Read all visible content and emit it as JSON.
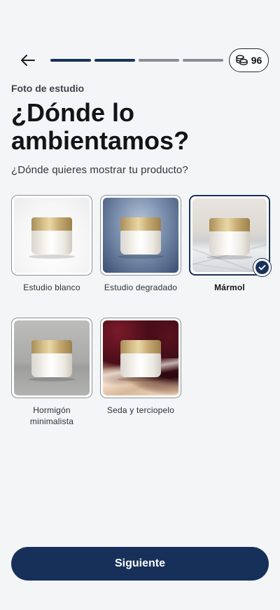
{
  "header": {
    "back_icon": "arrow-left-icon",
    "progress": {
      "total_steps": 4,
      "completed_steps": 2
    },
    "credits": {
      "icon": "coins-icon",
      "value": "96"
    }
  },
  "eyebrow": "Foto de estudio",
  "title": "¿Dónde lo ambientamos?",
  "subtitle": "¿Dónde quieres mostrar tu producto?",
  "options": [
    {
      "label": "Estudio blanco",
      "selected": false
    },
    {
      "label": "Estudio degradado",
      "selected": false
    },
    {
      "label": "Mármol",
      "selected": true
    },
    {
      "label": "Hormigón minimalista",
      "selected": false
    },
    {
      "label": "Seda y terciopelo",
      "selected": false
    }
  ],
  "selected_check_icon": "check-icon",
  "colors": {
    "accent": "#1a3258",
    "background": "#f3f5f7"
  },
  "next_button": "Siguiente"
}
